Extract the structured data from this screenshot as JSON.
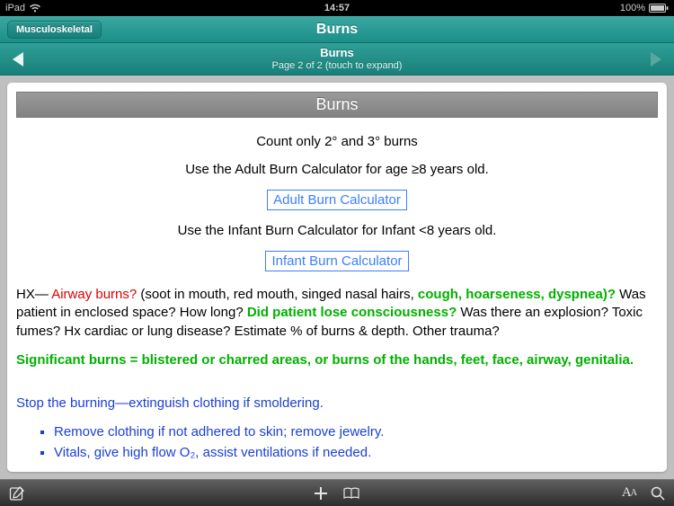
{
  "status_bar": {
    "device": "iPad",
    "time": "14:57",
    "battery_pct": "100%"
  },
  "nav": {
    "back_label": "Musculoskeletal",
    "title": "Burns"
  },
  "sub_bar": {
    "title": "Burns",
    "subtitle": "Page 2 of 2 (touch to expand)"
  },
  "page": {
    "header": "Burns",
    "intro_1": "Count only 2° and 3° burns",
    "intro_2": "Use the Adult Burn Calculator for age ≥8 years old.",
    "button_adult": "Adult Burn Calculator",
    "intro_3": "Use the Infant Burn Calculator for Infant <8 years old.",
    "button_infant": "Infant Burn Calculator",
    "hx_label": "HX—",
    "hx_airway": "Airway burns?",
    "hx_mid_1": "(soot in mouth, red mouth, singed nasal hairs,",
    "hx_symptoms": "cough, hoarseness, dyspnea)?",
    "hx_mid_2": "Was patient in enclosed space? How long?",
    "hx_loc": "Did patient lose consciousness?",
    "hx_mid_3": "Was there an explosion? Toxic fumes? Hx cardiac or lung disease? Estimate % of burns & depth. Other trauma?",
    "significant": "Significant burns = blistered or charred areas, or burns of the hands, feet, face, airway, genitalia.",
    "stop_burning": "Stop the burning—extinguish clothing if smoldering.",
    "bullets": [
      "Remove clothing if not adhered to skin; remove jewelry.",
      "Vitals, give high flow O₂, assist ventilations if needed."
    ]
  }
}
